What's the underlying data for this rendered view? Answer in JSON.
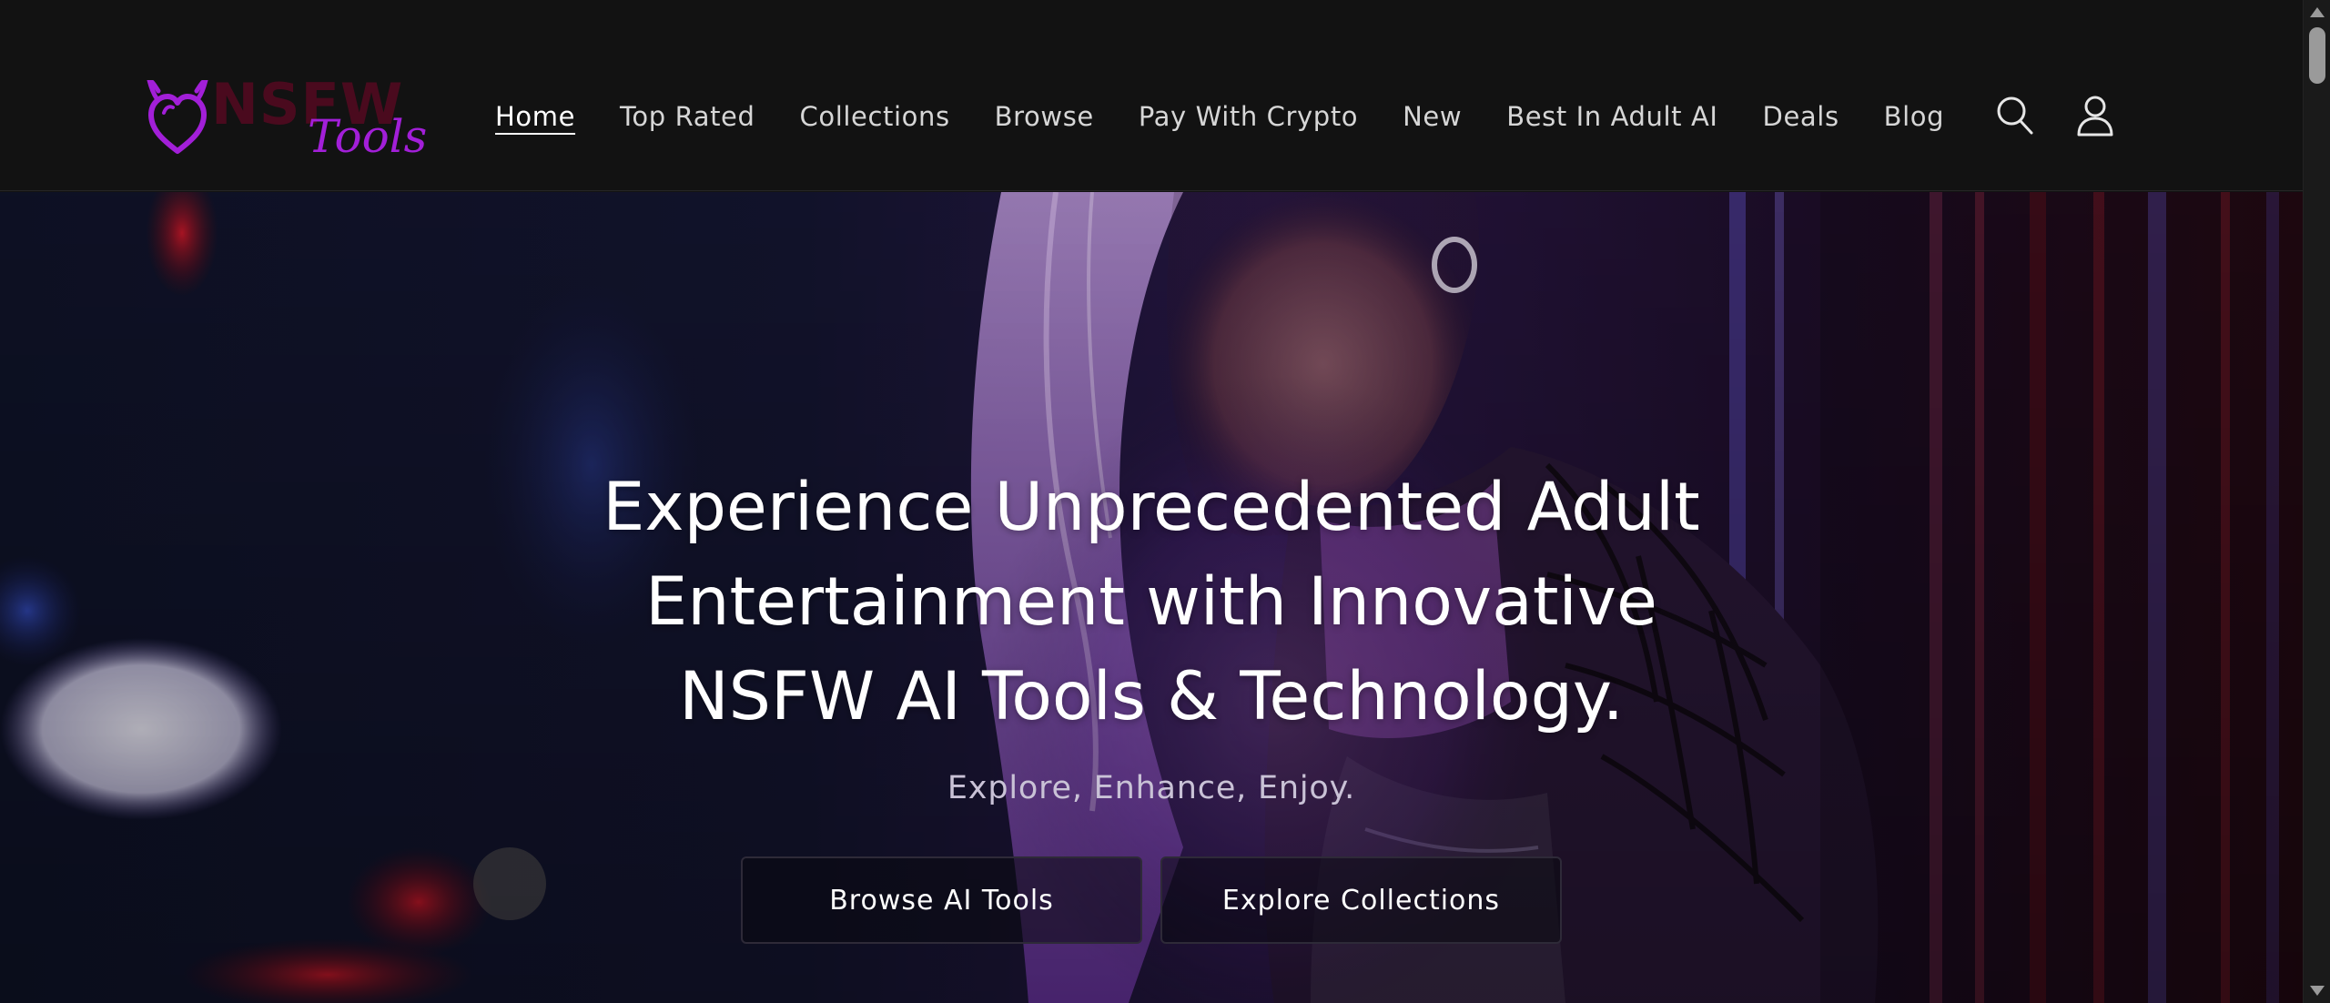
{
  "header": {
    "logo": {
      "word_top": "NSFW",
      "word_bottom": "Tools",
      "icon": "devil-heart-icon",
      "accent_color": "#a21fd8",
      "dark_color": "#4a0a1e"
    },
    "nav": [
      {
        "label": "Home",
        "active": true
      },
      {
        "label": "Top Rated",
        "active": false
      },
      {
        "label": "Collections",
        "active": false
      },
      {
        "label": "Browse",
        "active": false
      },
      {
        "label": "Pay With Crypto",
        "active": false
      },
      {
        "label": "New",
        "active": false
      },
      {
        "label": "Best In Adult AI",
        "active": false
      },
      {
        "label": "Deals",
        "active": false
      },
      {
        "label": "Blog",
        "active": false
      }
    ],
    "icons": [
      "search-icon",
      "account-icon"
    ]
  },
  "hero": {
    "title_lines": [
      "Experience Unprecedented Adult",
      "Entertainment with Innovative",
      "NSFW AI Tools & Technology."
    ],
    "subtitle": "Explore, Enhance, Enjoy.",
    "buttons": {
      "primary": "Browse AI Tools",
      "secondary": "Explore Collections"
    },
    "background": "purple-lit-illustrated-woman-neon-night-scene"
  },
  "colors": {
    "header_bg": "#121212",
    "nav_text": "#d6d6d6",
    "hero_text": "#ffffff"
  }
}
